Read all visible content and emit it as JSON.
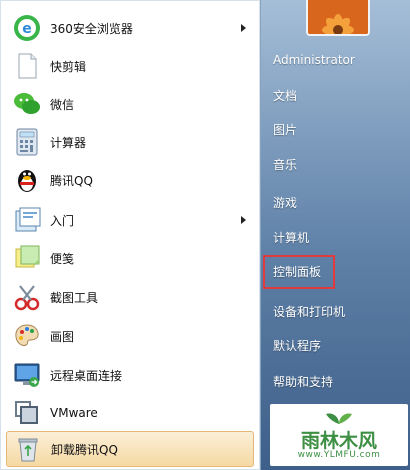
{
  "start_menu": {
    "programs": [
      {
        "label": "360安全浏览器",
        "icon": "360-browser-icon",
        "has_submenu": true
      },
      {
        "label": "快剪辑",
        "icon": "document-icon",
        "has_submenu": false
      },
      {
        "label": "微信",
        "icon": "wechat-icon",
        "has_submenu": false
      },
      {
        "label": "计算器",
        "icon": "calculator-icon",
        "has_submenu": false
      },
      {
        "label": "腾讯QQ",
        "icon": "qq-penguin-icon",
        "has_submenu": false
      },
      {
        "label": "入门",
        "icon": "getting-started-icon",
        "has_submenu": true
      },
      {
        "label": "便笺",
        "icon": "sticky-notes-icon",
        "has_submenu": false
      },
      {
        "label": "截图工具",
        "icon": "snipping-tool-icon",
        "has_submenu": false
      },
      {
        "label": "画图",
        "icon": "paint-palette-icon",
        "has_submenu": false
      },
      {
        "label": "远程桌面连接",
        "icon": "remote-desktop-icon",
        "has_submenu": false
      },
      {
        "label": "VMware",
        "icon": "vmware-icon",
        "has_submenu": false
      },
      {
        "label": "卸载腾讯QQ",
        "icon": "recycle-bin-icon",
        "has_submenu": false
      }
    ],
    "right_panel": {
      "user": "Administrator",
      "items": [
        "文档",
        "图片",
        "音乐",
        "游戏",
        "计算机",
        "控制面板",
        "设备和打印机",
        "默认程序",
        "帮助和支持"
      ],
      "highlighted": "控制面板"
    },
    "watermark": {
      "text": "雨林木风",
      "url": "www.YLMFU.com"
    },
    "colors": {
      "highlight_border": "#e23b3b",
      "hover_bg": "#f6d9a3",
      "watermark_green": "#3d8f43"
    }
  }
}
